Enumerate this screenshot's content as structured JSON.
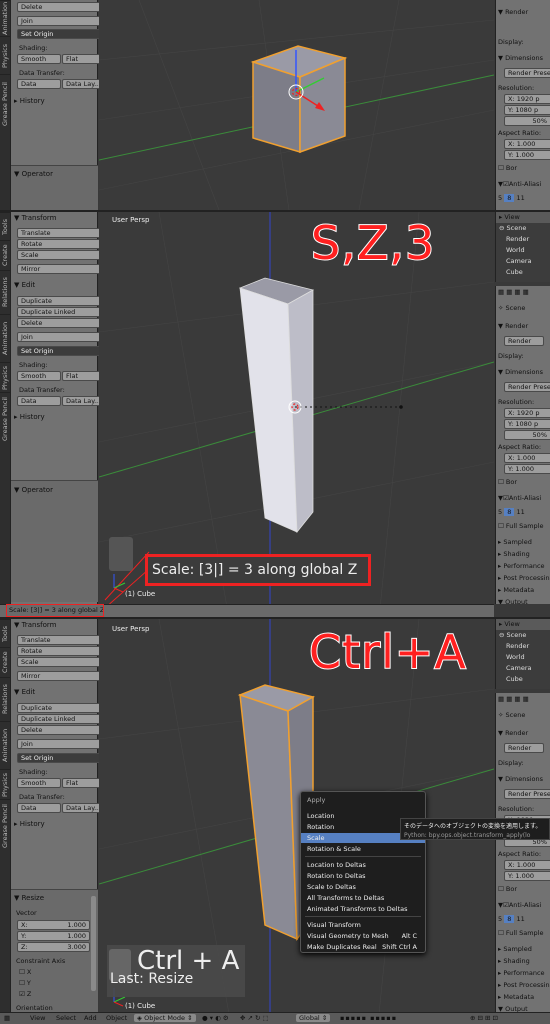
{
  "panel_tabs_1": [
    "Animation",
    "Physics",
    "Grease Pencil"
  ],
  "panel_tabs": [
    "Tools",
    "Create",
    "Relations",
    "Animation",
    "Physics",
    "Grease Pencil"
  ],
  "tools": {
    "transform_header": "Transform",
    "translate": "Translate",
    "rotate": "Rotate",
    "scale": "Scale",
    "mirror": "Mirror",
    "edit_header": "Edit",
    "duplicate": "Duplicate",
    "duplicate_linked": "Duplicate Linked",
    "delete": "Delete",
    "join": "Join",
    "set_origin": "Set Origin",
    "shading_label": "Shading:",
    "smooth": "Smooth",
    "flat": "Flat",
    "data_transfer_label": "Data Transfer:",
    "data": "Data",
    "data_layout": "Data Lay...",
    "history_header": "History",
    "operator_header": "Operator"
  },
  "resize_panel": {
    "header": "Resize",
    "vector_label": "Vector",
    "x": "X:",
    "x_val": "1.000",
    "y": "Y:",
    "y_val": "1.000",
    "z": "Z:",
    "z_val": "3.000",
    "constraint_label": "Constraint Axis",
    "cx": "X",
    "cy": "Y",
    "cz": "Z",
    "orientation_label": "Orientation"
  },
  "viewport": {
    "view_name": "User Persp",
    "object_label": "(1) Cube"
  },
  "annotations": {
    "step2_keys": "S,Z,3",
    "step3_keys": "Ctrl+A",
    "scale_callout": "Scale: [3|] = 3 along global Z",
    "status_bar": "Scale: [3|] = 3 along global Z",
    "ctrl_a_overlay": "Ctrl + A",
    "last_resize": "Last: Resize"
  },
  "apply_menu": {
    "title": "Apply",
    "items": [
      "Location",
      "Rotation",
      "Scale",
      "Rotation & Scale",
      "Location to Deltas",
      "Rotation to Deltas",
      "Scale to Deltas",
      "All Transforms to Deltas",
      "Animated Transforms to Deltas",
      "Visual Transform",
      "Visual Geometry to Mesh",
      "Make Duplicates Real"
    ],
    "shortcut_geometry": "Alt C",
    "shortcut_duplicates": "Shift Ctrl A",
    "selected": "Scale"
  },
  "tooltip": {
    "line1": "そのデータへのオブジェクトの変換を適用します。",
    "line2": "Python: bpy.ops.object.transform_apply(lo"
  },
  "properties": {
    "render_header": "Render",
    "render_btn": "Render",
    "display_label": "Display:",
    "dimensions_header": "Dimensions",
    "render_presets": "Render Presets",
    "resolution_label": "Resolution:",
    "res_x": "X:",
    "res_x_val": "1920 p",
    "res_y": "Y:",
    "res_y_val": "1080 p",
    "res_pct": "50%",
    "aspect_label": "Aspect Ratio:",
    "asp_x": "X:",
    "asp_x_val": "1.000",
    "asp_y": "Y:",
    "asp_y_val": "1.000",
    "border": "Bor",
    "antialias": "Anti-Aliasi",
    "aa_values": [
      "5",
      "8",
      "11"
    ],
    "full_sample": "Full Sample",
    "sampled": "Sampled",
    "shading": "Shading",
    "performance": "Performance",
    "post_processing": "Post Processin",
    "metadata": "Metadata",
    "output": "Output"
  },
  "outliner": {
    "view": "View",
    "scene": "Scene",
    "items": [
      "Scene",
      "Render",
      "World",
      "Camera",
      "Cube"
    ]
  },
  "header_bar": {
    "view": "View",
    "select": "Select",
    "add": "Add",
    "object": "Object",
    "mode": "Object Mode",
    "orientation": "Global"
  },
  "colors": {
    "annotation_red": "#ff2020",
    "menu_highlight": "#5680c2",
    "selection_orange": "#f0a030"
  }
}
